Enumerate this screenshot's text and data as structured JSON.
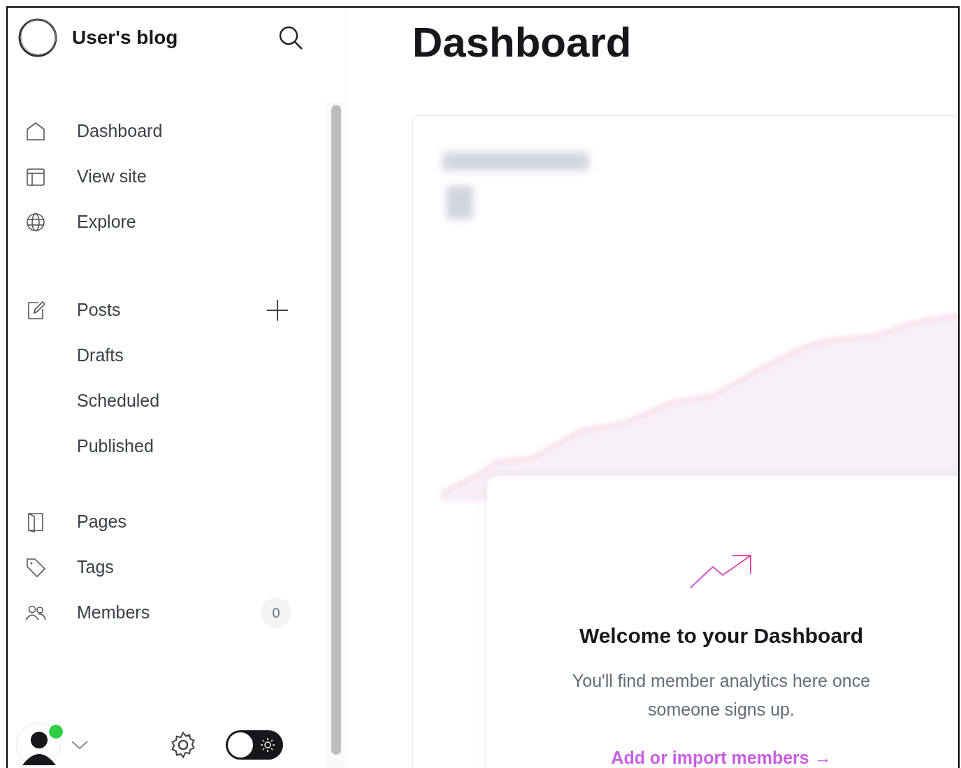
{
  "sidebar": {
    "brand": {
      "title": "User's blog"
    },
    "sections": [
      [
        {
          "label": "Dashboard"
        },
        {
          "label": "View site"
        },
        {
          "label": "Explore"
        }
      ],
      [
        {
          "label": "Posts",
          "add_button": true,
          "children": [
            {
              "label": "Drafts"
            },
            {
              "label": "Scheduled"
            },
            {
              "label": "Published"
            }
          ]
        }
      ],
      [
        {
          "label": "Pages"
        },
        {
          "label": "Tags"
        },
        {
          "label": "Members",
          "count": "0"
        }
      ]
    ],
    "footer": {
      "online": true,
      "theme_toggle": {
        "on": false
      }
    }
  },
  "main": {
    "title": "Dashboard",
    "welcome": {
      "heading": "Welcome to your Dashboard",
      "text": "You'll find member analytics here once someone signs up.",
      "link": "Add or import members →"
    }
  }
}
